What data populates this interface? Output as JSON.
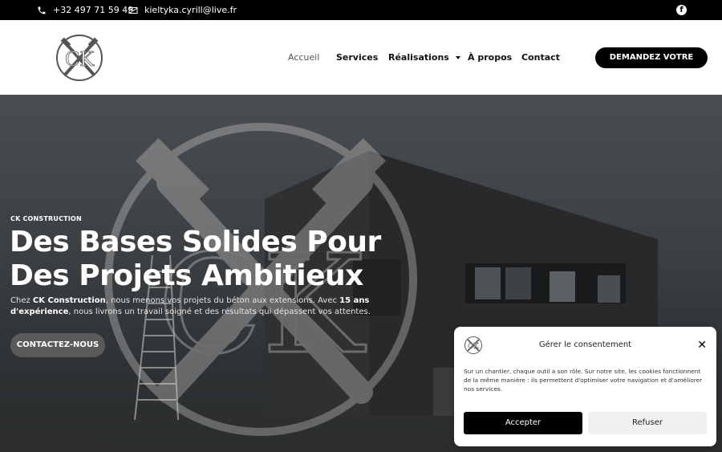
{
  "topbar": {
    "phone": "+32 497 71 59 49",
    "email": "kieltyka.cyrill@live.fr",
    "social_icon": "facebook-icon"
  },
  "header": {
    "nav": [
      {
        "label": "Accueil",
        "active": true
      },
      {
        "label": "Services"
      },
      {
        "label": "Réalisations",
        "has_dropdown": true
      },
      {
        "label": "À propos"
      },
      {
        "label": "Contact"
      }
    ],
    "quote_button": "DEMANDEZ VOTRE DEVIS"
  },
  "hero": {
    "eyebrow": "CK CONSTRUCTION",
    "headline_line1": "Des Bases Solides Pour",
    "headline_line2": "Des Projets Ambitieux",
    "desc_prefix": "Chez ",
    "desc_brand": "CK Construction",
    "desc_middle": ", nous menons vos projets du béton aux extensions. Avec ",
    "desc_years": "15 ans d'expérience",
    "desc_suffix": ", nous livrons un travail soigné et des résultats qui dépassent vos attentes.",
    "cta": "CONTACTEZ-NOUS"
  },
  "consent": {
    "title": "Gérer le consentement",
    "text": "Sur un chantier, chaque outil a son rôle. Sur notre site, les cookies fonctionnent de la même manière : ils permettent d'optimiser votre navigation et d'améliorer nos services.",
    "accept": "Accepter",
    "refuse": "Refuser"
  }
}
